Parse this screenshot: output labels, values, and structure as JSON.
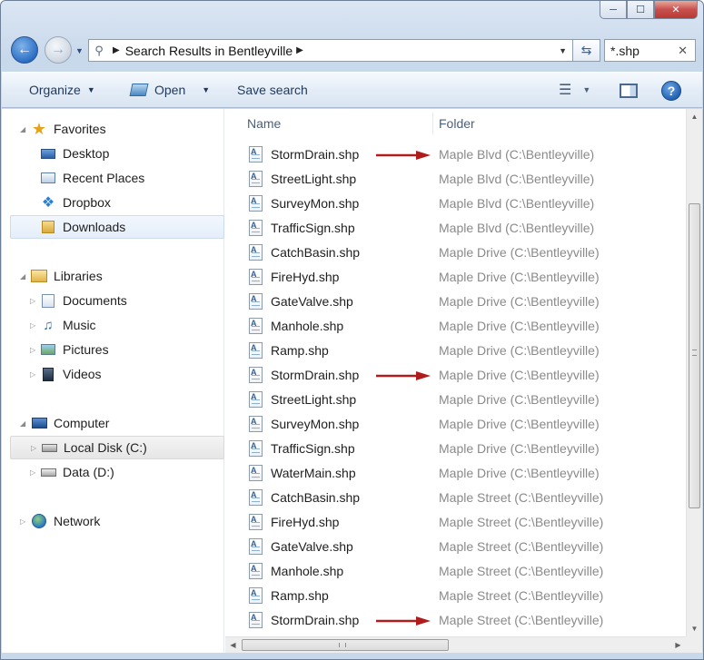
{
  "window": {
    "address_path": "Search Results in Bentleyville",
    "search_value": "*.shp"
  },
  "toolbar": {
    "organize_label": "Organize",
    "open_label": "Open",
    "save_search_label": "Save search"
  },
  "sidebar": {
    "favorites": "Favorites",
    "desktop": "Desktop",
    "recent_places": "Recent Places",
    "dropbox": "Dropbox",
    "downloads": "Downloads",
    "libraries": "Libraries",
    "documents": "Documents",
    "music": "Music",
    "pictures": "Pictures",
    "videos": "Videos",
    "computer": "Computer",
    "local_disk": "Local Disk (C:)",
    "data_disk": "Data (D:)",
    "network": "Network"
  },
  "columns": {
    "name": "Name",
    "folder": "Folder"
  },
  "files": [
    {
      "name": "StormDrain.shp",
      "folder": "Maple Blvd (C:\\Bentleyville)",
      "highlighted": true
    },
    {
      "name": "StreetLight.shp",
      "folder": "Maple Blvd (C:\\Bentleyville)",
      "highlighted": false
    },
    {
      "name": "SurveyMon.shp",
      "folder": "Maple Blvd (C:\\Bentleyville)",
      "highlighted": false
    },
    {
      "name": "TrafficSign.shp",
      "folder": "Maple Blvd (C:\\Bentleyville)",
      "highlighted": false
    },
    {
      "name": "CatchBasin.shp",
      "folder": "Maple Drive (C:\\Bentleyville)",
      "highlighted": false
    },
    {
      "name": "FireHyd.shp",
      "folder": "Maple Drive (C:\\Bentleyville)",
      "highlighted": false
    },
    {
      "name": "GateValve.shp",
      "folder": "Maple Drive (C:\\Bentleyville)",
      "highlighted": false
    },
    {
      "name": "Manhole.shp",
      "folder": "Maple Drive (C:\\Bentleyville)",
      "highlighted": false
    },
    {
      "name": "Ramp.shp",
      "folder": "Maple Drive (C:\\Bentleyville)",
      "highlighted": false
    },
    {
      "name": "StormDrain.shp",
      "folder": "Maple Drive (C:\\Bentleyville)",
      "highlighted": true
    },
    {
      "name": "StreetLight.shp",
      "folder": "Maple Drive (C:\\Bentleyville)",
      "highlighted": false
    },
    {
      "name": "SurveyMon.shp",
      "folder": "Maple Drive (C:\\Bentleyville)",
      "highlighted": false
    },
    {
      "name": "TrafficSign.shp",
      "folder": "Maple Drive (C:\\Bentleyville)",
      "highlighted": false
    },
    {
      "name": "WaterMain.shp",
      "folder": "Maple Drive (C:\\Bentleyville)",
      "highlighted": false
    },
    {
      "name": "CatchBasin.shp",
      "folder": "Maple Street (C:\\Bentleyville)",
      "highlighted": false
    },
    {
      "name": "FireHyd.shp",
      "folder": "Maple Street (C:\\Bentleyville)",
      "highlighted": false
    },
    {
      "name": "GateValve.shp",
      "folder": "Maple Street (C:\\Bentleyville)",
      "highlighted": false
    },
    {
      "name": "Manhole.shp",
      "folder": "Maple Street (C:\\Bentleyville)",
      "highlighted": false
    },
    {
      "name": "Ramp.shp",
      "folder": "Maple Street (C:\\Bentleyville)",
      "highlighted": false
    },
    {
      "name": "StormDrain.shp",
      "folder": "Maple Street (C:\\Bentleyville)",
      "highlighted": true
    }
  ],
  "colors": {
    "annotation_arrow": "#b01c1c",
    "folder_text": "#8a8a8a"
  }
}
